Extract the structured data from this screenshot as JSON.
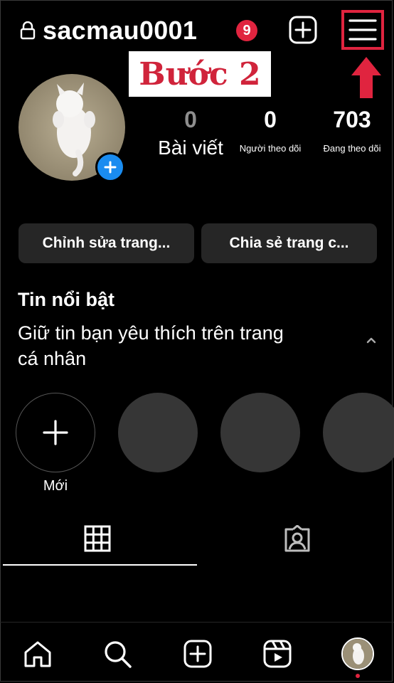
{
  "header": {
    "username": "sacmau0001",
    "notification_count": "9",
    "icons": {
      "lock": "lock-icon",
      "create": "plus-square-icon",
      "menu": "hamburger-menu-icon"
    }
  },
  "annotation": {
    "step_label": "Bước 2",
    "arrow": "red-up-arrow"
  },
  "profile": {
    "stats": [
      {
        "count": "0",
        "label": "Bài viết"
      },
      {
        "count": "0",
        "label": "Người theo dõi"
      },
      {
        "count": "703",
        "label": "Đang theo dõi"
      }
    ]
  },
  "actions": {
    "edit_profile": "Chỉnh sửa trang...",
    "share_profile": "Chia sẻ trang c..."
  },
  "highlights": {
    "title": "Tin nổi bật",
    "description": "Giữ tin bạn yêu thích trên trang cá nhân",
    "new_label": "Mới"
  },
  "tabs": {
    "active": "grid",
    "icons": [
      "grid-icon",
      "tagged-icon"
    ]
  },
  "bottom_nav": {
    "icons": [
      "home-icon",
      "search-icon",
      "create-icon",
      "reels-icon",
      "profile-avatar"
    ]
  },
  "colors": {
    "background": "#000000",
    "accent_red": "#e0243f",
    "blue": "#1a8cf0",
    "button": "#262626"
  }
}
